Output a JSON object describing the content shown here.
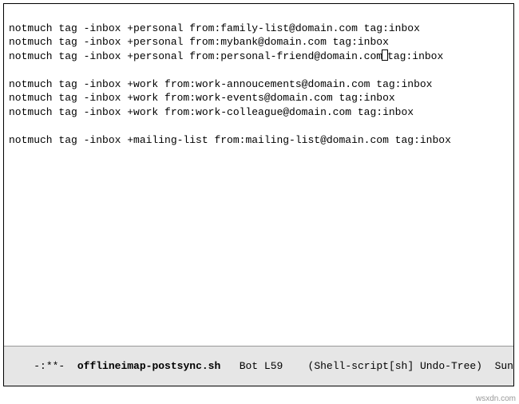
{
  "buffer": {
    "lines": [
      "",
      "notmuch tag -inbox +personal from:family-list@domain.com tag:inbox",
      "notmuch tag -inbox +personal from:mybank@domain.com tag:inbox",
      "__CURSOR_LINE__",
      "",
      "notmuch tag -inbox +work from:work-annoucements@domain.com tag:inbox",
      "notmuch tag -inbox +work from:work-events@domain.com tag:inbox",
      "notmuch tag -inbox +work from:work-colleague@domain.com tag:inbox",
      "",
      "notmuch tag -inbox +mailing-list from:mailing-list@domain.com tag:inbox"
    ],
    "cursor_line_before": "notmuch tag -inbox +personal from:personal-friend@domain.com",
    "cursor_line_after": "tag:inbox"
  },
  "modeline": {
    "status": "-:**-",
    "filename": "offlineimap-postsync.sh",
    "position": "Bot",
    "line": "L59",
    "modes": "(Shell-script[sh] Undo-Tree)",
    "time": "Sun F"
  },
  "watermark": "wsxdn.com"
}
